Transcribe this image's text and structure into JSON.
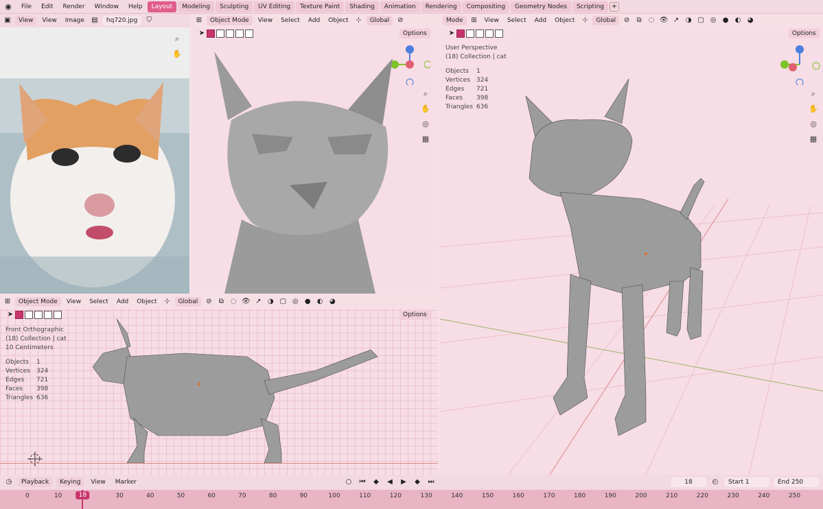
{
  "topbar": {
    "menus": [
      "File",
      "Edit",
      "Render",
      "Window",
      "Help"
    ],
    "workspace_tabs": [
      "Layout",
      "Modeling",
      "Sculpting",
      "UV Editing",
      "Texture Paint",
      "Shading",
      "Animation",
      "Rendering",
      "Compositing",
      "Geometry Nodes",
      "Scripting"
    ],
    "active_tab": "Layout"
  },
  "image_editor": {
    "view_menu": "View",
    "menus": [
      "View",
      "Image"
    ],
    "image_name": "hq720.jpg"
  },
  "viewport_top": {
    "mode": "Object Mode",
    "menus": [
      "View",
      "Select",
      "Add",
      "Object"
    ],
    "orientation": "Global",
    "options": "Options"
  },
  "viewport_persp": {
    "mode": "Mode",
    "menus": [
      "View",
      "Select",
      "Add",
      "Object"
    ],
    "orientation": "Global",
    "options": "Options",
    "title": "User Perspective",
    "collection": "(18) Collection | cat",
    "stats": [
      {
        "label": "Objects",
        "value": "1"
      },
      {
        "label": "Vertices",
        "value": "324"
      },
      {
        "label": "Edges",
        "value": "721"
      },
      {
        "label": "Faces",
        "value": "398"
      },
      {
        "label": "Triangles",
        "value": "636"
      }
    ]
  },
  "viewport_front": {
    "mode": "Object Mode",
    "menus": [
      "View",
      "Select",
      "Add",
      "Object"
    ],
    "orientation": "Global",
    "options": "Options",
    "title": "Front Orthographic",
    "collection": "(18) Collection | cat",
    "scale": "10 Centimeters",
    "stats": [
      {
        "label": "Objects",
        "value": "1"
      },
      {
        "label": "Vertices",
        "value": "324"
      },
      {
        "label": "Edges",
        "value": "721"
      },
      {
        "label": "Faces",
        "value": "398"
      },
      {
        "label": "Triangles",
        "value": "636"
      }
    ]
  },
  "timeline": {
    "menus": [
      "Playback",
      "Keying",
      "View",
      "Marker"
    ],
    "current_frame": "18",
    "start_label": "Start",
    "start": "1",
    "end_label": "End",
    "end": "250",
    "ticks": [
      "0",
      "10",
      "18",
      "30",
      "40",
      "50",
      "60",
      "70",
      "80",
      "90",
      "100",
      "110",
      "120",
      "130",
      "140",
      "150",
      "160",
      "170",
      "180",
      "190",
      "200",
      "210",
      "220",
      "230",
      "240",
      "250"
    ]
  },
  "colors": {
    "accent": "#e05d8c",
    "frame": "#c8356c",
    "bg": "#f7dfe6"
  }
}
